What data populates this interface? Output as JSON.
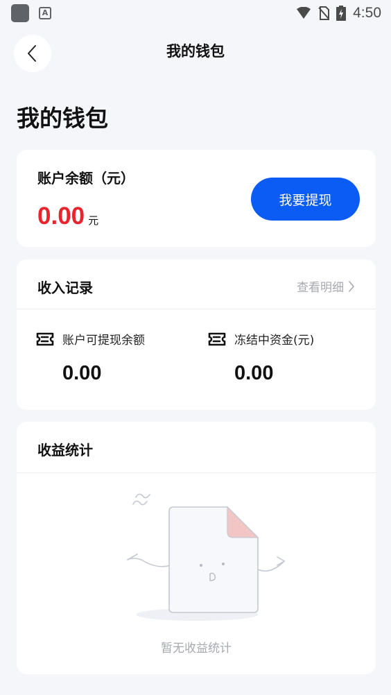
{
  "status_bar": {
    "time": "4:50",
    "app_badge_letter": "A"
  },
  "nav": {
    "title": "我的钱包",
    "back_icon": "chevron-left-icon"
  },
  "page_title": "我的钱包",
  "balance": {
    "label": "账户余额（元）",
    "amount": "0.00",
    "unit": "元",
    "withdraw_label": "我要提现"
  },
  "income": {
    "title": "收入记录",
    "detail_link": "查看明细",
    "stats": [
      {
        "label": "账户可提现余额",
        "value": "0.00",
        "icon": "ticket-icon"
      },
      {
        "label": "冻结中资金(元)",
        "value": "0.00",
        "icon": "ticket-icon"
      }
    ]
  },
  "earnings": {
    "title": "收益统计",
    "empty_text": "暂无收益统计"
  },
  "colors": {
    "accent": "#0a5cf5",
    "amount_red": "#e8242c",
    "background": "#f5f6fa",
    "muted_text": "#a6a9b0"
  }
}
